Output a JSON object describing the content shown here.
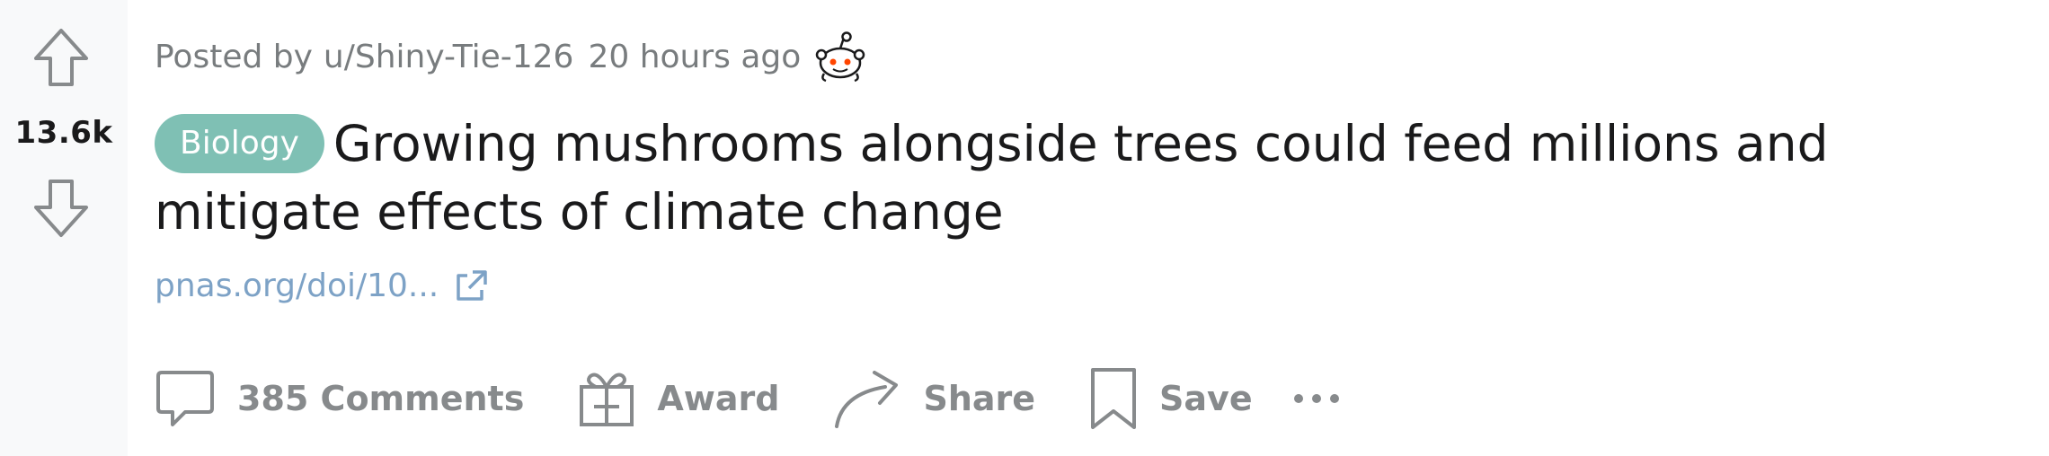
{
  "vote": {
    "score": "13.6k",
    "upvote_icon": "arrow-up-icon",
    "downvote_icon": "arrow-down-icon"
  },
  "meta": {
    "posted_by_label": "Posted by",
    "author": "u/Shiny-Tie-126",
    "time": "20 hours ago",
    "avatar_icon": "snoo-avatar-icon"
  },
  "post": {
    "flair": "Biology",
    "title": "Growing mushrooms alongside trees could feed millions and mitigate effects of climate change",
    "link_text": "pnas.org/doi/10...",
    "link_icon": "external-link-icon"
  },
  "actions": {
    "comments_label": "385 Comments",
    "award_label": "Award",
    "share_label": "Share",
    "save_label": "Save",
    "more_icon": "more-dots-icon"
  },
  "colors": {
    "flair_bg": "#7fc0b4",
    "link": "#7da2c6",
    "muted": "#787c7e",
    "action": "#878a8c",
    "title": "#1a1a1b",
    "vote_col_bg": "#f8f9fa"
  }
}
